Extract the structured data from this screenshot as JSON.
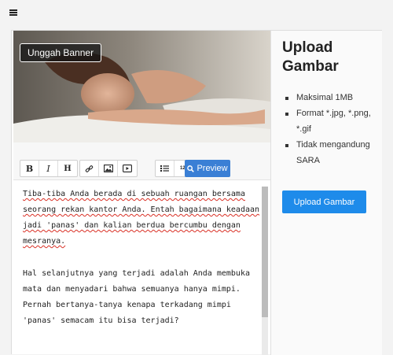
{
  "topbar": {
    "menu_icon": "hamburger-menu-icon"
  },
  "banner": {
    "upload_button_label": "Unggah Banner"
  },
  "toolbar": {
    "bold": "B",
    "italic": "I",
    "heading": "H",
    "link_icon": "link-icon",
    "image_icon": "image-icon",
    "video_icon": "video-icon",
    "list_icon": "bulleted-list-icon",
    "numbered": "123",
    "preview_label": "Preview"
  },
  "editor": {
    "paragraphs": [
      [
        "Tiba-tiba Anda berada di sebuah ruangan bersama",
        "seorang rekan kantor Anda. Entah bagaimana keadaan",
        "jadi 'panas' dan kalian berdua bercumbu dengan",
        "mesranya."
      ],
      [
        "Hal selanjutnya yang terjadi adalah Anda membuka",
        "mata dan menyadari bahwa semuanya hanya mimpi.",
        "Pernah bertanya-tanya kenapa terkadang mimpi",
        "'panas' semacam itu bisa terjadi?"
      ]
    ]
  },
  "sidebar": {
    "title": "Upload Gambar",
    "rules": [
      "Maksimal 1MB",
      "Format *.jpg, *.png, *.gif",
      "Tidak mengandung SARA"
    ],
    "upload_button_label": "Upload Gambar"
  },
  "colors": {
    "accent": "#1e8bea",
    "preview": "#3a7fd5",
    "spellcheck": "#d93025"
  }
}
